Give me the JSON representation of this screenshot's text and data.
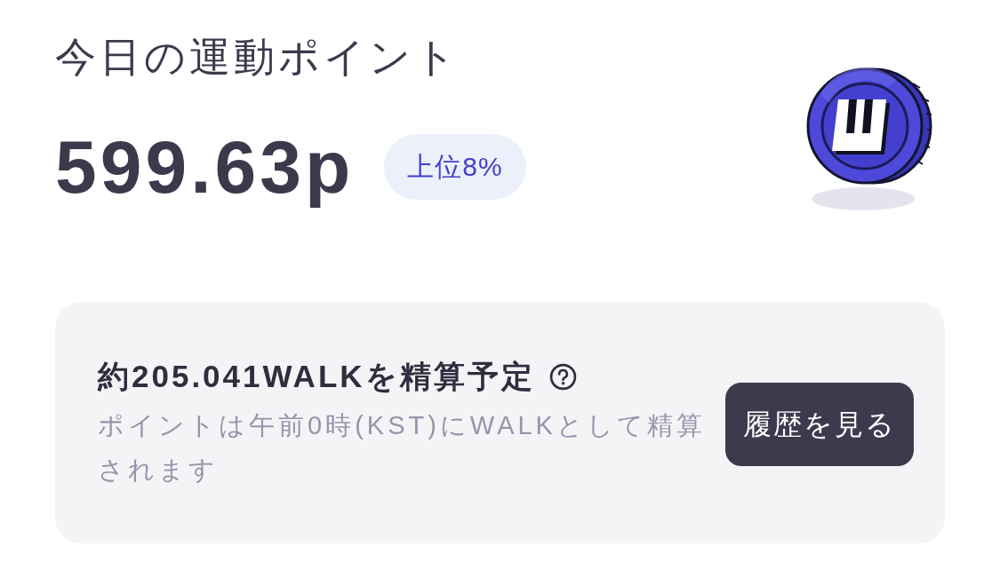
{
  "header": {
    "title": "今日の運動ポイント",
    "points": "599.63p",
    "rank_badge": "上位8%"
  },
  "settlement_card": {
    "heading": "約205.041WALKを精算予定",
    "note": "ポイントは午前0時(KST)にWALKとして精算されます",
    "button": "履歴を見る"
  }
}
